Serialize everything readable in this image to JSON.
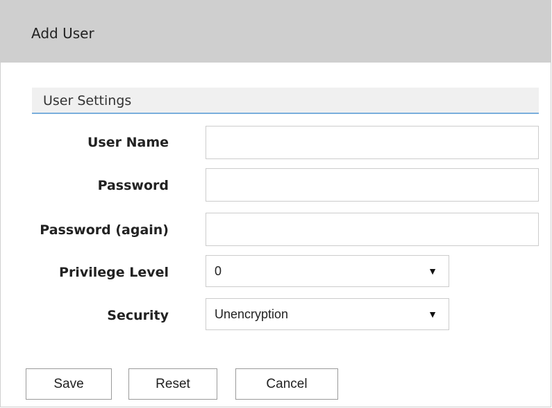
{
  "dialog": {
    "title": "Add User"
  },
  "section": {
    "title": "User Settings"
  },
  "form": {
    "user_name": {
      "label": "User Name",
      "value": ""
    },
    "password": {
      "label": "Password",
      "value": ""
    },
    "password_again": {
      "label": "Password (again)",
      "value": ""
    },
    "privilege_level": {
      "label": "Privilege Level",
      "value": "0"
    },
    "security": {
      "label": "Security",
      "value": "Unencryption"
    }
  },
  "icons": {
    "dropdown_arrow": "▼"
  },
  "buttons": {
    "save": "Save",
    "reset": "Reset",
    "cancel": "Cancel"
  },
  "colors": {
    "header_bg": "#cfcfcf",
    "section_bg": "#f0f0f0",
    "section_accent": "#7aaedc"
  }
}
